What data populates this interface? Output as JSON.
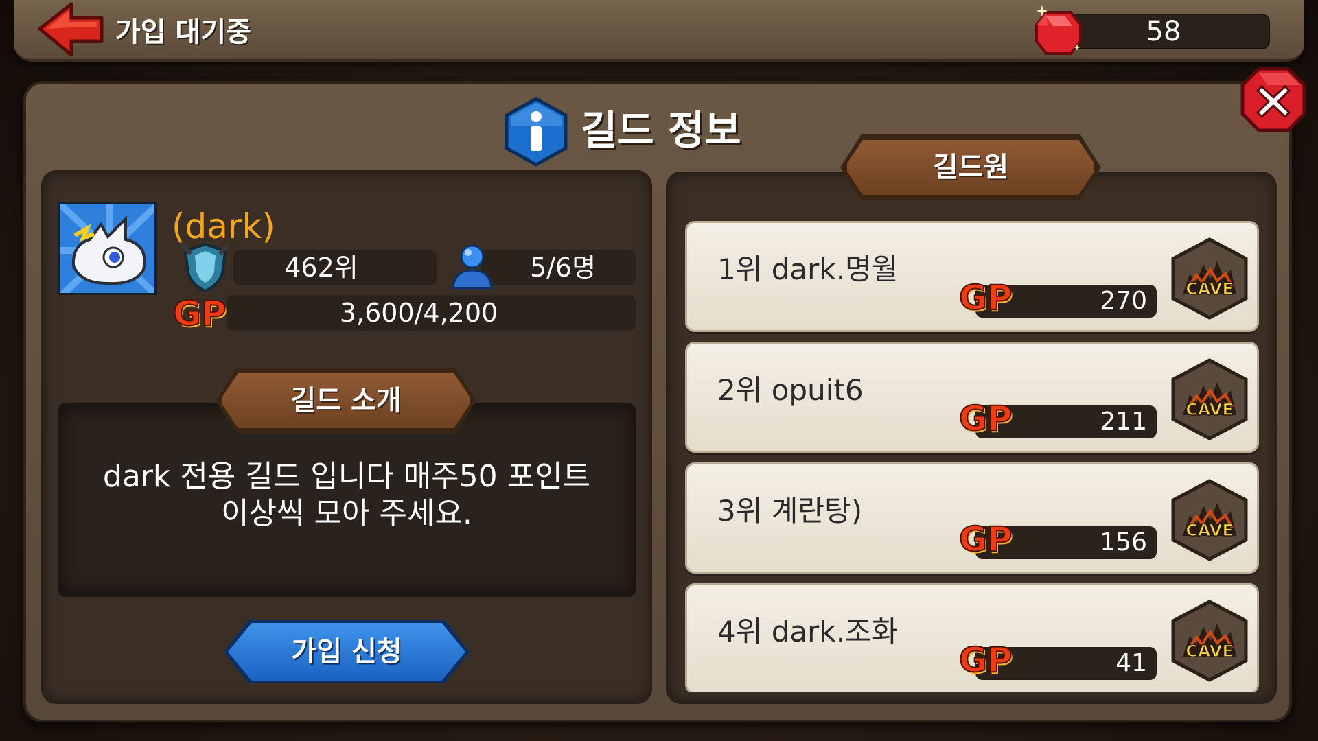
{
  "top_bar": {
    "title": "가입 대기중",
    "gems": "58"
  },
  "dialog": {
    "title": "길드 정보"
  },
  "guild": {
    "name": "(dark)",
    "rank": "462위",
    "members": "5/6명",
    "gp_label": "GP",
    "gp": "3,600/4,200",
    "intro_tab": "길드 소개",
    "intro_line1": "dark 전용 길드 입니다 매주50 포인트",
    "intro_line2": "이상씩 모아 주세요.",
    "join_button": "가입 신청"
  },
  "members_tab": "길드원",
  "members": [
    {
      "name": "1위 dark.명월",
      "gp_label": "GP",
      "gp": "270",
      "badge": "CAVE"
    },
    {
      "name": "2위 opuit6",
      "gp_label": "GP",
      "gp": "211",
      "badge": "CAVE"
    },
    {
      "name": "3위 계란탕)",
      "gp_label": "GP",
      "gp": "156",
      "badge": "CAVE"
    },
    {
      "name": "4위 dark.조화",
      "gp_label": "GP",
      "gp": "41",
      "badge": "CAVE"
    }
  ],
  "colors": {
    "gold_name": "#f3a51e",
    "gp_red": "#f03b12",
    "join_blue": "#2b7bd8",
    "close_red": "#d9202a"
  }
}
